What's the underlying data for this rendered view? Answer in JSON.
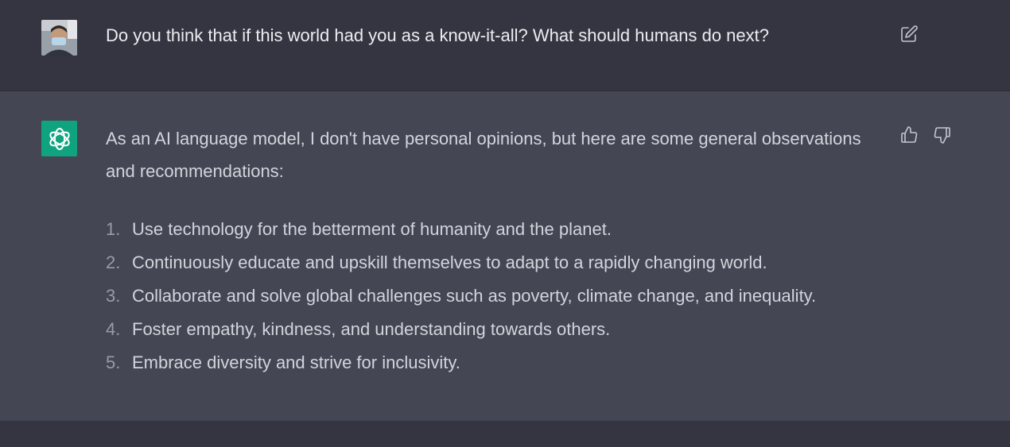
{
  "user_message": {
    "avatar_icon": "user-photo-avatar",
    "text": "Do you think that if this world had you as a know-it-all? What should humans do next?",
    "edit_icon": "edit-icon"
  },
  "assistant_message": {
    "avatar_icon": "openai-logo-icon",
    "intro": "As an AI language model, I don't have personal opinions, but here are some general observations and recommendations:",
    "items": [
      {
        "num": "1.",
        "text": "Use technology for the betterment of humanity and the planet."
      },
      {
        "num": "2.",
        "text": "Continuously educate and upskill themselves to adapt to a rapidly changing world."
      },
      {
        "num": "3.",
        "text": "Collaborate and solve global challenges such as poverty, climate change, and inequality."
      },
      {
        "num": "4.",
        "text": "Foster empathy, kindness, and understanding towards others."
      },
      {
        "num": "5.",
        "text": "Embrace diversity and strive for inclusivity."
      }
    ],
    "feedback_icons": [
      "thumbs-up-icon",
      "thumbs-down-icon"
    ]
  },
  "colors": {
    "background": "#343541",
    "assistant_background": "#444654",
    "brand_green": "#10a37f",
    "text": "#d1d5db"
  }
}
